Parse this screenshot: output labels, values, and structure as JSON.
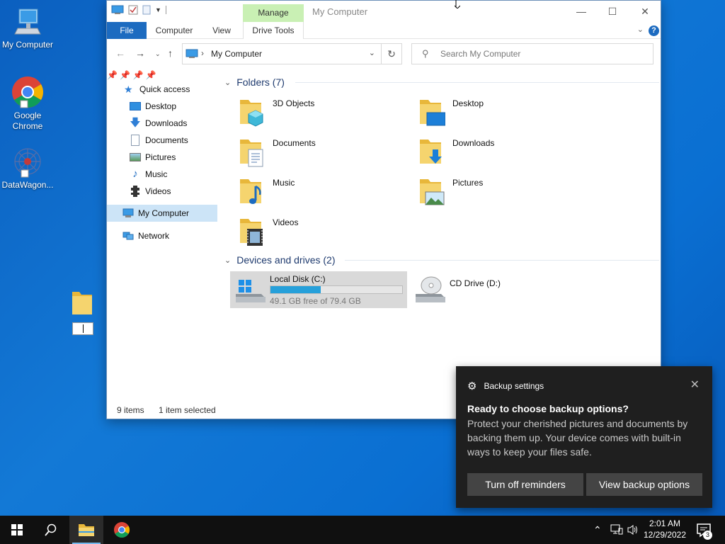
{
  "desktop": {
    "icons": [
      {
        "label": "My Computer"
      },
      {
        "label": "Google Chrome"
      },
      {
        "label": "DataWagon..."
      }
    ]
  },
  "explorer": {
    "title": "My Computer",
    "manage_tab": "Manage",
    "ribbon_tabs": [
      "File",
      "Computer",
      "View",
      "Drive Tools"
    ],
    "address": "My Computer",
    "search_placeholder": "Search My Computer",
    "nav": {
      "quick_access": "Quick access",
      "items": [
        "Desktop",
        "Downloads",
        "Documents",
        "Pictures",
        "Music",
        "Videos"
      ],
      "this_pc": "My Computer",
      "network": "Network"
    },
    "folders_header": "Folders (7)",
    "folders": [
      "3D Objects",
      "Desktop",
      "Documents",
      "Downloads",
      "Music",
      "Pictures",
      "Videos"
    ],
    "drives_header": "Devices and drives (2)",
    "drives": [
      {
        "name": "Local Disk (C:)",
        "free_text": "49.1 GB free of 79.4 GB",
        "used_fraction": 0.38
      },
      {
        "name": "CD Drive (D:)"
      }
    ],
    "status": {
      "items": "9 items",
      "selected": "1 item selected"
    }
  },
  "toast": {
    "app": "Backup settings",
    "title": "Ready to choose backup options?",
    "body": "Protect your cherished pictures and documents by backing them up. Your device comes with built-in ways to keep your files safe.",
    "btn_off": "Turn off reminders",
    "btn_view": "View backup options"
  },
  "taskbar": {
    "time": "2:01 AM",
    "date": "12/29/2022",
    "notifications": "3"
  },
  "colors": {
    "accent": "#1c6bc0",
    "manage": "#c9f0b4",
    "drive_fill": "#26a0da",
    "toast_bg": "#1f1f1f"
  }
}
